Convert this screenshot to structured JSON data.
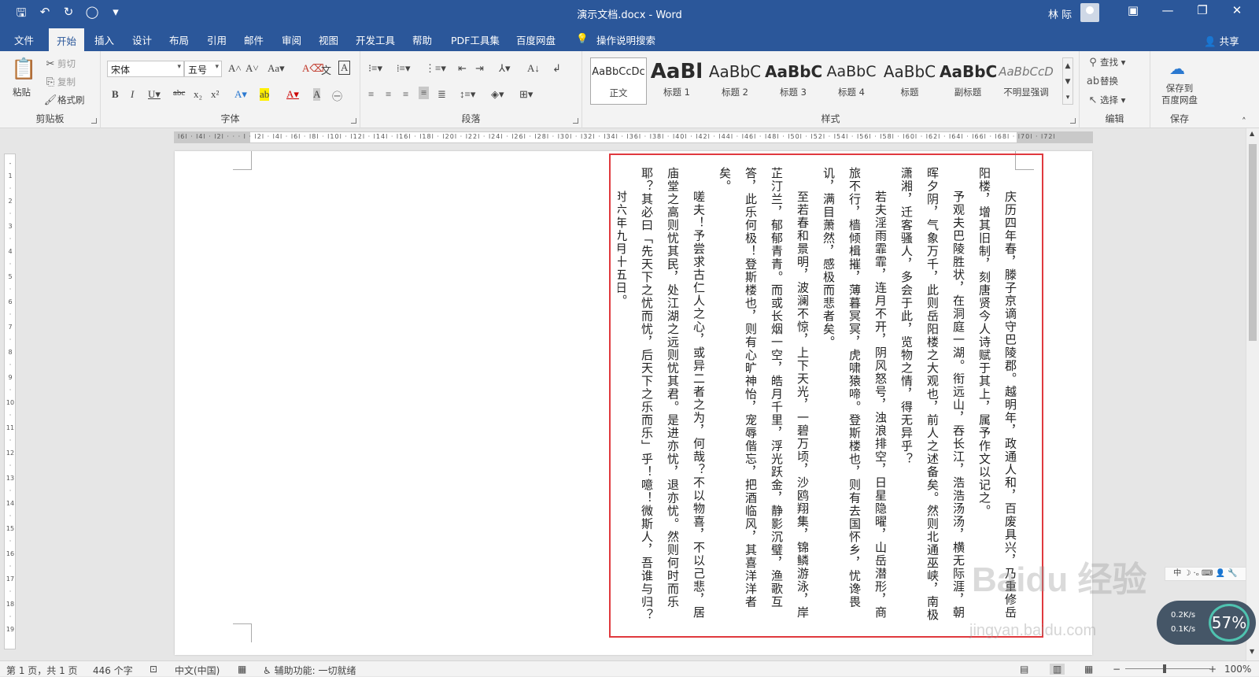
{
  "window": {
    "title": "演示文档.docx  -  Word",
    "user": "林 际"
  },
  "menu": {
    "tabs": [
      "文件",
      "开始",
      "插入",
      "设计",
      "布局",
      "引用",
      "邮件",
      "审阅",
      "视图",
      "开发工具",
      "帮助",
      "PDF工具集",
      "百度网盘",
      "操作说明搜索"
    ],
    "active": "开始",
    "share": "共享"
  },
  "clipboard": {
    "paste": "粘贴",
    "cut": "剪切",
    "copy": "复制",
    "painter": "格式刷",
    "label": "剪贴板"
  },
  "font": {
    "name": "宋体",
    "size": "五号",
    "label": "字体"
  },
  "paragraph": {
    "label": "段落"
  },
  "styles": {
    "label": "样式",
    "items": [
      {
        "preview": "AaBbCcDc",
        "name": "正文"
      },
      {
        "preview": "AaBl",
        "name": "标题 1"
      },
      {
        "preview": "AaBbC",
        "name": "标题 2"
      },
      {
        "preview": "AaBbC",
        "name": "标题 3"
      },
      {
        "preview": "AaBbC",
        "name": "标题 4"
      },
      {
        "preview": "AaBbC",
        "name": "标题"
      },
      {
        "preview": "AaBbC",
        "name": "副标题"
      },
      {
        "preview": "AaBbCcD",
        "name": "不明显强调"
      }
    ]
  },
  "editing": {
    "find": "查找",
    "replace": "替换",
    "select": "选择",
    "label": "编辑"
  },
  "save": {
    "button": "保存到\n百度网盘",
    "label": "保存"
  },
  "document": {
    "paragraphs": [
      "庆历四年春，滕子京谪守巴陵郡。越明年，政通人和，百废具兴，乃重修岳阳楼，增其旧制，刻唐贤今人诗赋于其上，属予作文以记之。",
      "予观夫巴陵胜状，在洞庭一湖。衔远山，吞长江，浩浩汤汤，横无际涯，朝晖夕阴，气象万千，此则岳阳楼之大观也，前人之述备矣。然则北通巫峡，南极潇湘，迁客骚人，多会于此，览物之情，得无异乎？",
      "若夫淫雨霏霏，连月不开，阴风怒号，浊浪排空，日星隐曜，山岳潜形，商旅不行，樯倾楫摧，薄暮冥冥，虎啸猿啼。登斯楼也，则有去国怀乡，忧谗畏讥，满目萧然，感极而悲者矣。",
      "至若春和景明，波澜不惊，上下天光，一碧万顷，沙鸥翔集，锦鳞游泳，岸芷汀兰，郁郁青青。而或长烟一空，皓月千里，浮光跃金，静影沉璧，渔歌互答，此乐何极！登斯楼也，则有心旷神怡，宠辱偕忘，把酒临风，其喜洋洋者矣。",
      "嗟夫！予尝求古仁人之心，或异二者之为，何哉？不以物喜，不以己悲，居庙堂之高则忧其民，处江湖之远则忧其君。是进亦忧，退亦忧。然则何时而乐耶？其必曰「先天下之忧而忧，后天下之乐而乐」乎！噫！微斯人，吾谁与归？",
      "时六年九月十五日。"
    ]
  },
  "status": {
    "page": "第 1 页，共 1 页",
    "words": "446 个字",
    "lang": "中文(中国)",
    "access": "辅助功能: 一切就绪",
    "zoom": "100%"
  },
  "overlay": {
    "speed_up": "0.2K/s",
    "speed_down": "0.1K/s",
    "percent": "57%",
    "watermark": "Baidu 经验",
    "watermark_url": "jingyan.baidu.com"
  }
}
